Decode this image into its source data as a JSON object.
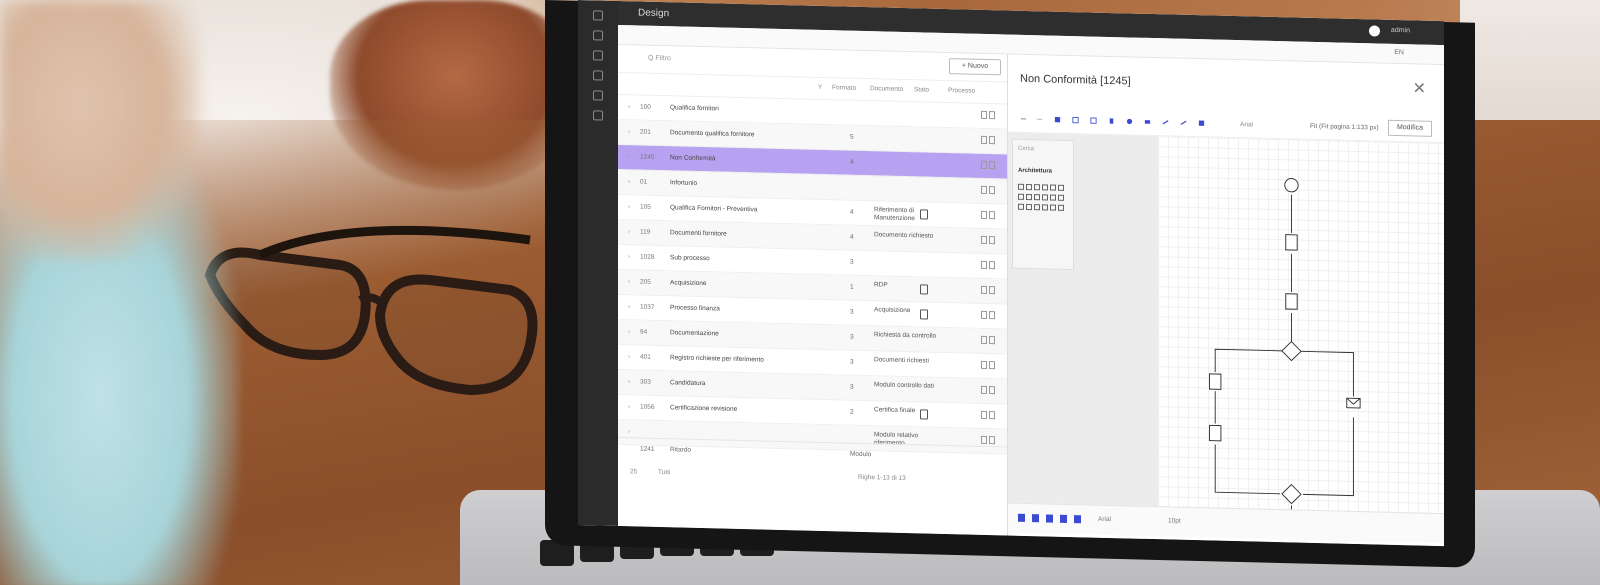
{
  "app": {
    "title": "Design",
    "user_name": "admin",
    "language": "EN",
    "new_button": "+ Nuovo",
    "search_placeholder": "Q  Filtro"
  },
  "list": {
    "columns": [
      "Y",
      "Formato",
      "Documento",
      "Stato",
      "Processo"
    ],
    "rows": [
      {
        "code": "100",
        "name": "Qualifica fornitori",
        "num": "",
        "stato": "",
        "selected": false,
        "doc": false
      },
      {
        "code": "201",
        "name": "Documento qualifica fornitore",
        "num": "5",
        "stato": "",
        "selected": false,
        "doc": false
      },
      {
        "code": "1245",
        "name": "Non Conformità",
        "num": "4",
        "stato": "",
        "selected": true,
        "doc": false
      },
      {
        "code": "01",
        "name": "Infortunio",
        "num": "",
        "stato": "",
        "selected": false,
        "doc": false
      },
      {
        "code": "105",
        "name": "Qualifica Fornitori - Preventiva",
        "num": "4",
        "stato": "Riferimento di Manutenzione",
        "selected": false,
        "doc": true
      },
      {
        "code": "119",
        "name": "Documenti fornitore",
        "num": "4",
        "stato": "Documento richiesto",
        "selected": false,
        "doc": false
      },
      {
        "code": "1028",
        "name": "Sub processo",
        "num": "3",
        "stato": "",
        "selected": false,
        "doc": false
      },
      {
        "code": "205",
        "name": "Acquisizione",
        "num": "1",
        "stato": "RDP",
        "selected": false,
        "doc": true
      },
      {
        "code": "1037",
        "name": "Processo finanza",
        "num": "3",
        "stato": "Acquisizione",
        "selected": false,
        "doc": true
      },
      {
        "code": "94",
        "name": "Documentazione",
        "num": "3",
        "stato": "Richiesta da controllo",
        "selected": false,
        "doc": false
      },
      {
        "code": "401",
        "name": "Registro richieste per riferimento",
        "num": "3",
        "stato": "Documenti richiesti",
        "selected": false,
        "doc": false
      },
      {
        "code": "303",
        "name": "Candidatura",
        "num": "3",
        "stato": "Modulo controllo dati",
        "selected": false,
        "doc": false
      },
      {
        "code": "1056",
        "name": "Certificazione revisione",
        "num": "2",
        "stato": "Certifica finale",
        "selected": false,
        "doc": true
      },
      {
        "code": "",
        "name": "",
        "num": "",
        "stato": "Modulo relativo riferimento",
        "selected": false,
        "doc": false
      }
    ],
    "footer": {
      "code": "1241",
      "name": "Ritardo",
      "count_label": "Tutti",
      "page_size": "25",
      "stato": "Modulo"
    },
    "pager_label": "Righe 1-13 di 13"
  },
  "designer": {
    "title": "Non Conformità [1245]",
    "modify_button": "Modifica",
    "font_name": "Arial",
    "zoom_label": "Fit (Fit pagina 1:133 px)",
    "palette_search": "Cerca",
    "palette_title": "Architettura",
    "format_font": "Arial",
    "format_size": "10pt"
  },
  "colors": {
    "selected_row": "#b6a2f0",
    "accent": "#3b4bd1",
    "topbar": "#2e2e2e"
  },
  "icons": [
    "search-icon",
    "close-icon",
    "document-icon",
    "gear-icon",
    "diamond-gateway-icon",
    "mail-icon"
  ]
}
